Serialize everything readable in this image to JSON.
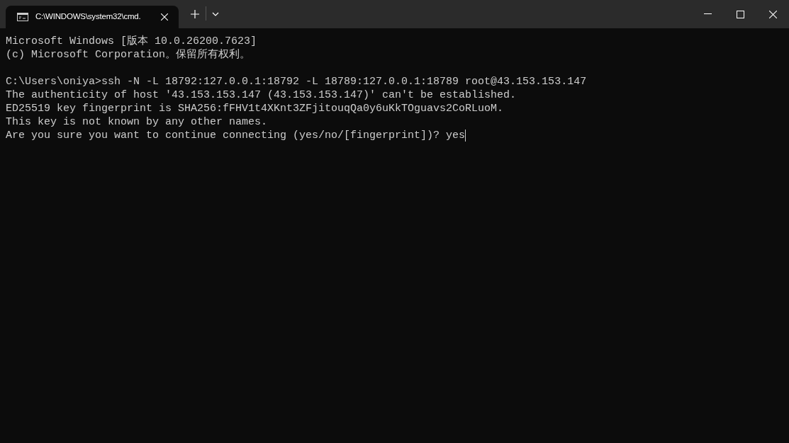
{
  "tabs": [
    {
      "title": "C:\\WINDOWS\\system32\\cmd.",
      "selected": true
    }
  ],
  "terminal": {
    "blocks": [
      [
        "Microsoft Windows [版本 10.0.26200.7623]",
        "(c) Microsoft Corporation。保留所有权利。"
      ],
      [
        "C:\\Users\\oniya>ssh -N -L 18792:127.0.0.1:18792 -L 18789:127.0.0.1:18789 root@43.153.153.147",
        "The authenticity of host '43.153.153.147 (43.153.153.147)' can't be established.",
        "ED25519 key fingerprint is SHA256:fFHV1t4XKnt3ZFjitouqQa0y6uKkTOguavs2CoRLuoM.",
        "This key is not known by any other names.",
        "Are you sure you want to continue connecting (yes/no/[fingerprint])? yes"
      ]
    ],
    "cursor": true
  }
}
